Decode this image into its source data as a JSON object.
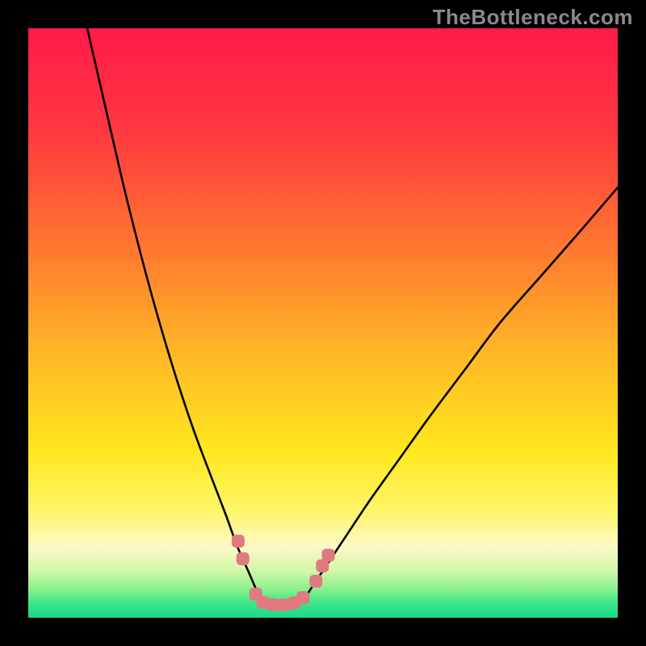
{
  "watermark": "TheBottleneck.com",
  "chart_data": {
    "type": "line",
    "title": "",
    "xlabel": "",
    "ylabel": "",
    "xlim": [
      0,
      100
    ],
    "ylim": [
      0,
      100
    ],
    "background": {
      "type": "vertical-gradient",
      "stops": [
        {
          "pos": 0.0,
          "color": "#ff1a4b"
        },
        {
          "pos": 0.18,
          "color": "#ff3a3f"
        },
        {
          "pos": 0.38,
          "color": "#ff7a2f"
        },
        {
          "pos": 0.55,
          "color": "#ffb726"
        },
        {
          "pos": 0.72,
          "color": "#ffe81f"
        },
        {
          "pos": 0.82,
          "color": "#fff56a"
        },
        {
          "pos": 0.88,
          "color": "#fdf9c8"
        },
        {
          "pos": 0.92,
          "color": "#d2f7a8"
        },
        {
          "pos": 0.95,
          "color": "#8ef08e"
        },
        {
          "pos": 0.975,
          "color": "#3de68a"
        },
        {
          "pos": 1.0,
          "color": "#17d98a"
        }
      ]
    },
    "series": [
      {
        "name": "left-branch",
        "color": "#000000",
        "x": [
          10,
          13,
          16,
          19,
          22,
          25,
          28,
          31,
          33.5,
          35.5,
          37.5,
          39.2
        ],
        "y": [
          100,
          87,
          74,
          62,
          51,
          41,
          32,
          24,
          17.5,
          12,
          7.5,
          3.5
        ]
      },
      {
        "name": "right-branch",
        "color": "#000000",
        "x": [
          47,
          50,
          54,
          58,
          63,
          68,
          74,
          80,
          87,
          94,
          100
        ],
        "y": [
          3.5,
          8,
          14,
          20,
          27,
          34,
          42,
          50,
          58,
          66,
          73
        ]
      }
    ],
    "markers": {
      "name": "highlighted-points",
      "color": "#e07a7f",
      "size": 16,
      "points": [
        {
          "x": 35.6,
          "y": 13.0
        },
        {
          "x": 36.4,
          "y": 10.0
        },
        {
          "x": 38.6,
          "y": 4.0
        },
        {
          "x": 39.8,
          "y": 2.6
        },
        {
          "x": 41.6,
          "y": 2.2
        },
        {
          "x": 43.4,
          "y": 2.2
        },
        {
          "x": 45.1,
          "y": 2.5
        },
        {
          "x": 46.6,
          "y": 3.4
        },
        {
          "x": 48.8,
          "y": 6.2
        },
        {
          "x": 49.9,
          "y": 8.8
        },
        {
          "x": 50.9,
          "y": 10.6
        }
      ]
    }
  }
}
